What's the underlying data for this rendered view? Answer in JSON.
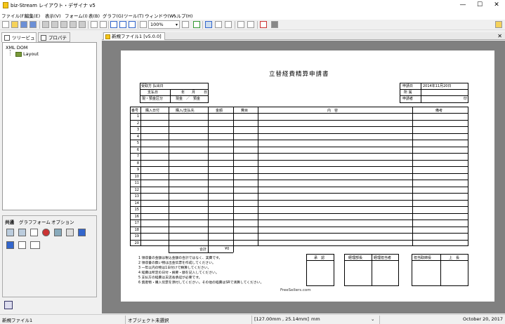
{
  "window": {
    "title": "biz-Stream レイアウト・デザイナ v5",
    "minimize": "—",
    "maximize": "☐",
    "close": "✕"
  },
  "menu": [
    "ファイル(F)",
    "編集(E)",
    "表示(V)",
    "フォーム(I)",
    "表(B)",
    "グラフ(G)",
    "ツール(T)",
    "ウィンドウ(W)",
    "ヘルプ(H)"
  ],
  "toolbar": {
    "zoom": "100%"
  },
  "left_panel": {
    "tabs": [
      "ツリービュー",
      "プロパティ"
    ],
    "tree_root": "XML DOM",
    "tree_leaf": "Layout",
    "palette_tabs": [
      "共通",
      "グラフ",
      "フォーム",
      "オプション"
    ]
  },
  "document": {
    "tab_title": "新規ファイル1 [v5.0.0]"
  },
  "form": {
    "title": "立替経費精算申請書",
    "name_label": "受取方 払出日",
    "account_label": "支払日",
    "date_parts": [
      "年",
      "月",
      "日"
    ],
    "kind_label": "現・預金区分",
    "kind_value": "現金　／　預金",
    "apply_date_label": "申請日",
    "apply_date_value": "2014年11月20日",
    "dept_label": "所 属",
    "applicant_label": "申請者",
    "applicant_seal": "印",
    "headers": [
      "番号",
      "購入日付",
      "購入/支払先",
      "金額",
      "費目",
      "内　容",
      "備考"
    ],
    "rows": [
      "1",
      "2",
      "3",
      "4",
      "5",
      "6",
      "7",
      "8",
      "9",
      "10",
      "11",
      "12",
      "13",
      "14",
      "15",
      "16",
      "17",
      "18",
      "19",
      "20"
    ],
    "total_label": "合計",
    "total_currency": "¥0",
    "notes": [
      "1 領収書の金額は税込金額の合計ではなく、実費です。",
      "2 領収書の無い物は出金伝票を作成してください。",
      "3 一年以内の物は1日付けで精算してください。",
      "4 経費は所定の日付・摘要・額を記入してください。",
      "5 支払方の経費は支店長承認が必要です。",
      "6 資産物・購入伝票を添付してください。その他の経費はSRで清算してください。"
    ],
    "footer": "FreeSellers.com",
    "stamp_groups": [
      [
        "承　認"
      ],
      [
        "経理部長",
        "経理担当者"
      ],
      [
        "担当取締役",
        "上　長"
      ]
    ]
  },
  "status": {
    "file": "新規ファイル1",
    "selection": "オブジェクト未選択",
    "coords": "[127.00mm , 25.14mm]",
    "unit": "mm",
    "date": "October 20, 2017"
  }
}
